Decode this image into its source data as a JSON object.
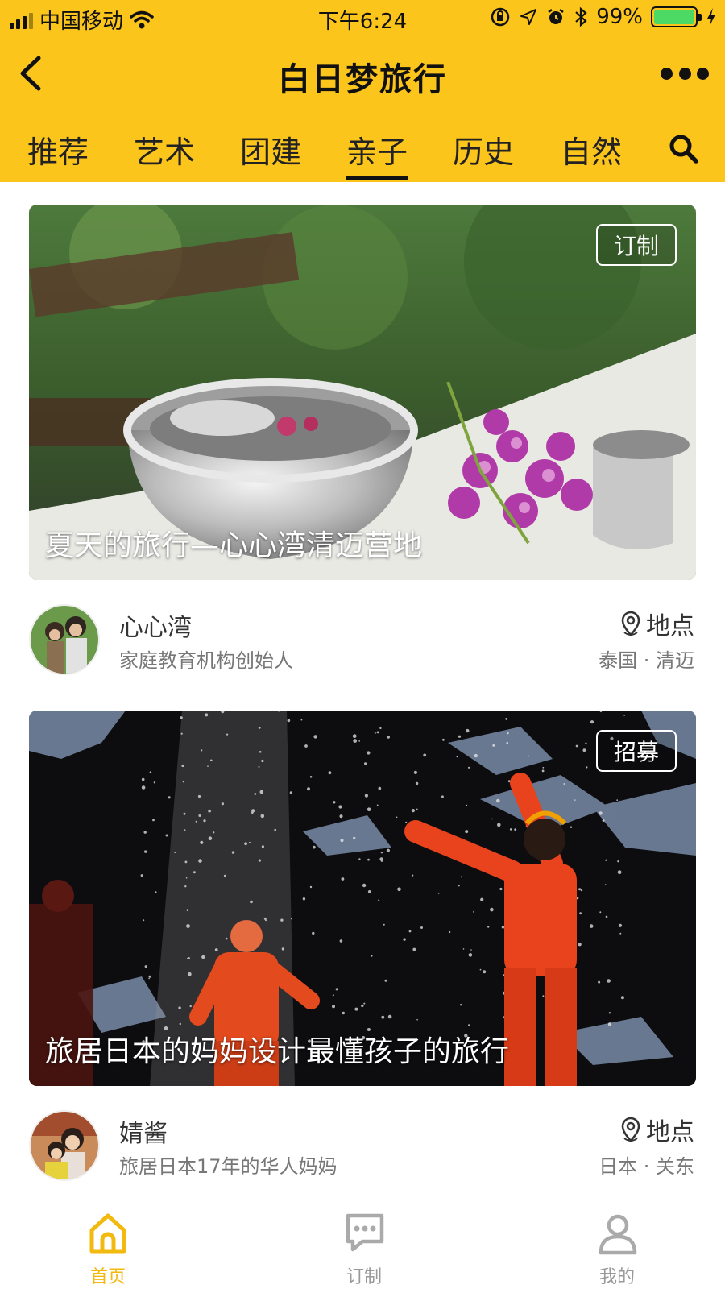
{
  "status_bar": {
    "carrier": "中国移动",
    "time": "下午6:24",
    "battery": "99%",
    "battery_level": 0.99
  },
  "navbar": {
    "title": "白日梦旅行",
    "back_icon": "chevron-left-icon",
    "more_icon": "more-dots-icon"
  },
  "tabs": {
    "items": [
      {
        "label": "推荐"
      },
      {
        "label": "艺术"
      },
      {
        "label": "团建"
      },
      {
        "label": "亲子",
        "active": true
      },
      {
        "label": "历史"
      },
      {
        "label": "自然"
      }
    ],
    "search_icon": "search-icon"
  },
  "cards": [
    {
      "tag": "订制",
      "title": "夏天的旅行—心心湾清迈营地",
      "author_name": "心心湾",
      "author_desc": "家庭教育机构创始人",
      "place_label": "地点",
      "place_value": "泰国 · 清迈"
    },
    {
      "tag": "招募",
      "title": "旅居日本的妈妈设计最懂孩子的旅行",
      "author_name": "婧酱",
      "author_desc": "旅居日本17年的华人妈妈",
      "place_label": "地点",
      "place_value": "日本 · 关东"
    }
  ],
  "tabbar": {
    "items": [
      {
        "label": "首页",
        "icon": "home-icon",
        "active": true
      },
      {
        "label": "订制",
        "icon": "chat-bubble-icon"
      },
      {
        "label": "我的",
        "icon": "user-icon"
      }
    ]
  },
  "colors": {
    "brand_yellow": "#fcc51c",
    "active_tab_yellow": "#f2b90f",
    "battery_green": "#4cd964"
  }
}
